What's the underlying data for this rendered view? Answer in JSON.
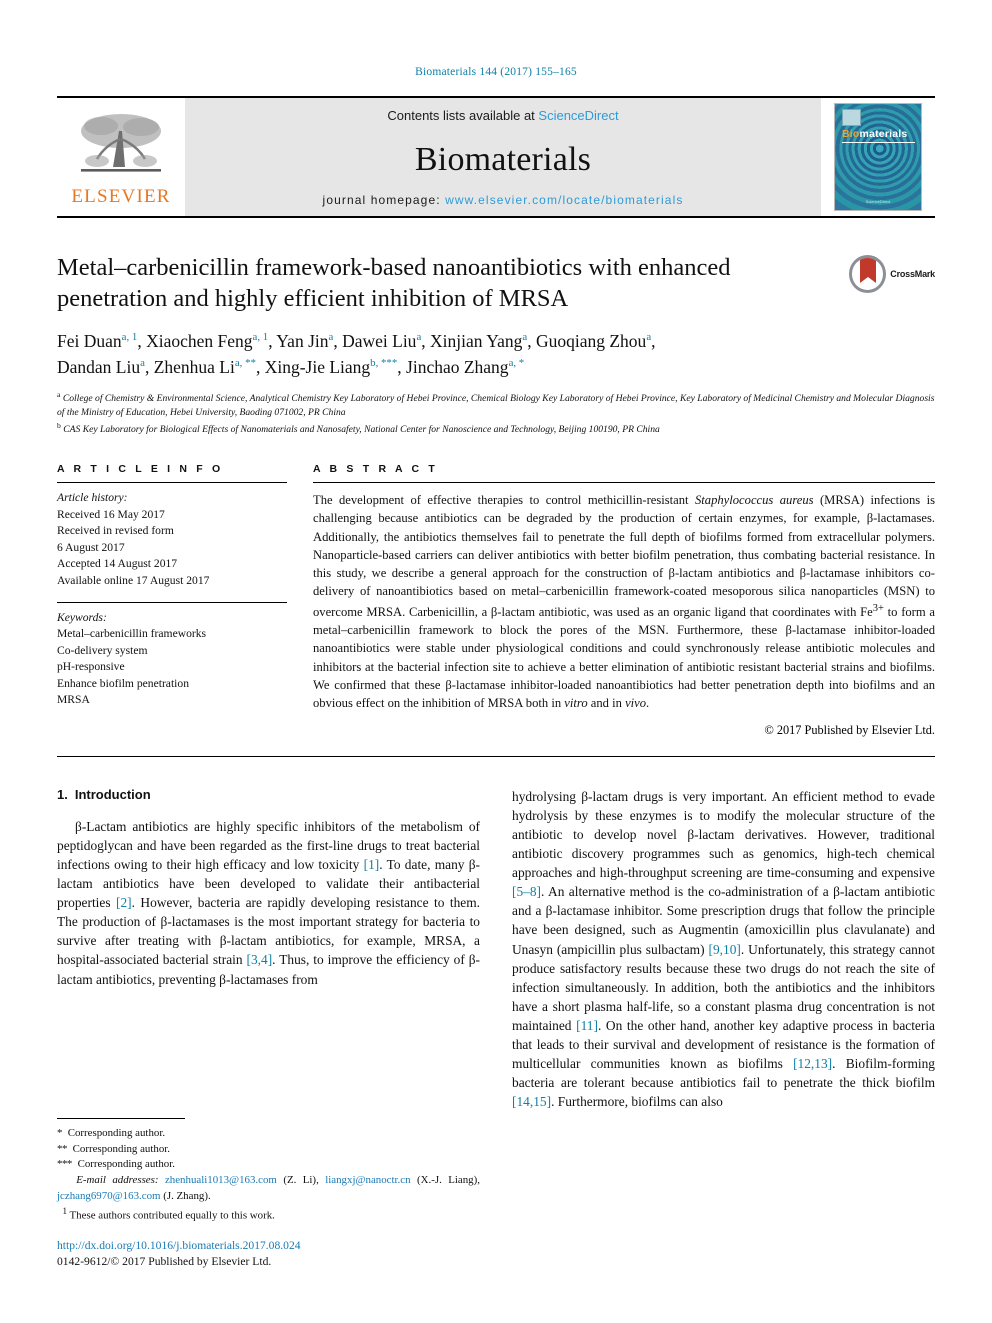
{
  "running_head": "Biomaterials 144 (2017) 155–165",
  "masthead": {
    "contents_prefix": "Contents lists available at ",
    "contents_link": "ScienceDirect",
    "journal_title": "Biomaterials",
    "homepage_prefix": "journal homepage: ",
    "homepage_url": "www.elsevier.com/locate/biomaterials",
    "publisher_logo_text": "ELSEVIER",
    "cover": {
      "title_part1": "Bio",
      "title_part2": "materials",
      "footer": "ScienceDirect"
    }
  },
  "article": {
    "title": "Metal–carbenicillin framework-based nanoantibiotics with enhanced penetration and highly efficient inhibition of MRSA",
    "crossmark_label": "CrossMark",
    "authors_line1": "Fei Duan a, 1, Xiaochen Feng a, 1, Yan Jin a, Dawei Liu a, Xinjian Yang a, Guoqiang Zhou a,",
    "authors_line2": "Dandan Liu a, Zhenhua Li a, **, Xing-Jie Liang b, ***, Jinchao Zhang a, *",
    "authors": [
      {
        "name": "Fei Duan",
        "marks": "a, 1"
      },
      {
        "name": "Xiaochen Feng",
        "marks": "a, 1"
      },
      {
        "name": "Yan Jin",
        "marks": "a"
      },
      {
        "name": "Dawei Liu",
        "marks": "a"
      },
      {
        "name": "Xinjian Yang",
        "marks": "a"
      },
      {
        "name": "Guoqiang Zhou",
        "marks": "a"
      },
      {
        "name": "Dandan Liu",
        "marks": "a"
      },
      {
        "name": "Zhenhua Li",
        "marks": "a, **"
      },
      {
        "name": "Xing-Jie Liang",
        "marks": "b, ***"
      },
      {
        "name": "Jinchao Zhang",
        "marks": "a, *"
      }
    ],
    "affiliations": [
      {
        "marker": "a",
        "text": "College of Chemistry & Environmental Science, Analytical Chemistry Key Laboratory of Hebei Province, Chemical Biology Key Laboratory of Hebei Province, Key Laboratory of Medicinal Chemistry and Molecular Diagnosis of the Ministry of Education, Hebei University, Baoding 071002, PR China"
      },
      {
        "marker": "b",
        "text": "CAS Key Laboratory for Biological Effects of Nanomaterials and Nanosafety, National Center for Nanoscience and Technology, Beijing 100190, PR China"
      }
    ]
  },
  "article_info": {
    "heading": "A R T I C L E   I N F O",
    "history_label": "Article history:",
    "history": [
      "Received 16 May 2017",
      "Received in revised form",
      "6 August 2017",
      "Accepted 14 August 2017",
      "Available online 17 August 2017"
    ],
    "keywords_label": "Keywords:",
    "keywords": [
      "Metal–carbenicillin frameworks",
      "Co-delivery system",
      "pH-responsive",
      "Enhance biofilm penetration",
      "MRSA"
    ]
  },
  "abstract": {
    "heading": "A B S T R A C T",
    "part1": "The development of effective therapies to control methicillin-resistant ",
    "italic1": "Staphylococcus aureus",
    "part2": " (MRSA) infections is challenging because antibiotics can be degraded by the production of certain enzymes, for example, β-lactamases. Additionally, the antibiotics themselves fail to penetrate the full depth of biofilms formed from extracellular polymers. Nanoparticle-based carriers can deliver antibiotics with better biofilm penetration, thus combating bacterial resistance. In this study, we describe a general approach for the construction of β-lactam antibiotics and β-lactamase inhibitors co-delivery of nanoantibiotics based on metal–carbenicillin framework-coated mesoporous silica nanoparticles (MSN) to overcome MRSA. Carbenicillin, a β-lactam antibiotic, was used as an organic ligand that coordinates with Fe",
    "sup1": "3+",
    "part3": " to form a metal–carbenicillin framework to block the pores of the MSN. Furthermore, these β-lactamase inhibitor-loaded nanoantibiotics were stable under physiological conditions and could synchronously release antibiotic molecules and inhibitors at the bacterial infection site to achieve a better elimination of antibiotic resistant bacterial strains and biofilms. We confirmed that these β-lactamase inhibitor-loaded nanoantibiotics had better penetration depth into biofilms and an obvious effect on the inhibition of MRSA both in ",
    "italic2": "vitro",
    "part4": " and in ",
    "italic3": "vivo",
    "part5": ".",
    "copyright": "© 2017 Published by Elsevier Ltd."
  },
  "introduction": {
    "number": "1.",
    "title": "Introduction",
    "left_p1_a": "β-Lactam antibiotics are highly specific inhibitors of the metabolism of peptidoglycan and have been regarded as the first-line drugs to treat bacterial infections owing to their high efficacy and low toxicity ",
    "ref1": "[1]",
    "left_p1_b": ". To date, many β-lactam antibiotics have been developed to validate their antibacterial properties ",
    "ref2": "[2]",
    "left_p1_c": ". However, bacteria are rapidly developing resistance to them. The production of β-lactamases is the most important strategy for bacteria to survive after treating with β-lactam antibiotics, for example, MRSA, a hospital-associated bacterial strain ",
    "ref3": "[3,4]",
    "left_p1_d": ". Thus, to improve the efficiency of β-lactam antibiotics, preventing β-lactamases from",
    "right_a": "hydrolysing β-lactam drugs is very important. An efficient method to evade hydrolysis by these enzymes is to modify the molecular structure of the antibiotic to develop novel β-lactam derivatives. However, traditional antibiotic discovery programmes such as genomics, high-tech chemical approaches and high-throughput screening are time-consuming and expensive ",
    "ref5": "[5–8]",
    "right_b": ". An alternative method is the co-administration of a β-lactam antibiotic and a β-lactamase inhibitor. Some prescription drugs that follow the principle have been designed, such as Augmentin (amoxicillin plus clavulanate) and Unasyn (ampicillin plus sulbactam) ",
    "ref9": "[9,10]",
    "right_c": ". Unfortunately, this strategy cannot produce satisfactory results because these two drugs do not reach the site of infection simultaneously. In addition, both the antibiotics and the inhibitors have a short plasma half-life, so a constant plasma drug concentration is not maintained ",
    "ref11": "[11]",
    "right_d": ". On the other hand, another key adaptive process in bacteria that leads to their survival and development of resistance is the formation of multicellular communities known as biofilms ",
    "ref12": "[12,13]",
    "right_e": ". Biofilm-forming bacteria are tolerant because antibiotics fail to penetrate the thick biofilm ",
    "ref14": "[14,15]",
    "right_f": ". Furthermore, biofilms can also"
  },
  "footnotes": {
    "corr1_mark": "*",
    "corr1": "Corresponding author.",
    "corr2_mark": "**",
    "corr2": "Corresponding author.",
    "corr3_mark": "***",
    "corr3": "Corresponding author.",
    "email_label": "E-mail addresses:",
    "email1": "zhenhuali1013@163.com",
    "email1_owner": "(Z. Li)",
    "email2": "liangxj@nanoctr.cn",
    "email2_owner": "(X.-J. Liang)",
    "email3": "jczhang6970@163.com",
    "email3_owner": "(J. Zhang)",
    "equal_mark": "1",
    "equal_contrib": "These authors contributed equally to this work.",
    "doi": "http://dx.doi.org/10.1016/j.biomaterials.2017.08.024",
    "issn": "0142-9612/© 2017 Published by Elsevier Ltd."
  },
  "colors": {
    "link": "#1a7ab5",
    "running_head": "#0d7fa6",
    "elsevier_orange": "#e87722",
    "crossmark_red": "#c0392b"
  }
}
